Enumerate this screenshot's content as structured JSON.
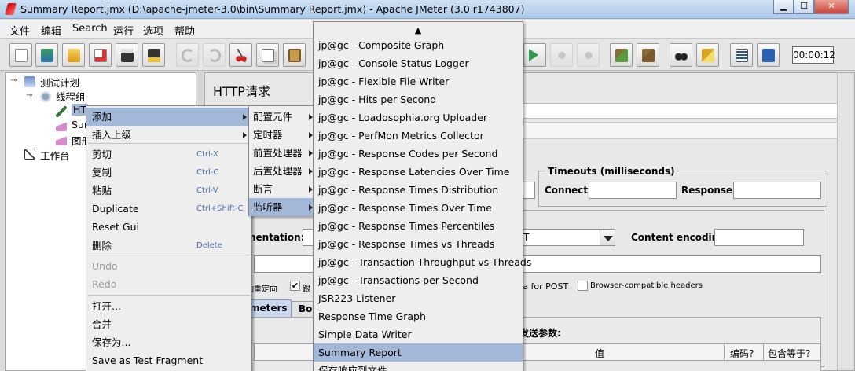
{
  "window": {
    "title": "Summary Report.jmx (D:\\apache-jmeter-3.0\\bin\\Summary Report.jmx) - Apache JMeter (3.0 r1743807)",
    "minimize": "▁",
    "maximize": "☐",
    "close": "✕"
  },
  "menubar": [
    "文件",
    "编辑",
    "Search",
    "运行",
    "选项",
    "帮助"
  ],
  "toolbar": {
    "timer": "00:00:12"
  },
  "tree": {
    "plan": "测试计划",
    "thread_group": "线程组",
    "http_partial": "HT",
    "summary_partial": "Sur",
    "graph_partial": "图册",
    "workbench": "工作台"
  },
  "panel": {
    "title": "HTTP请求",
    "timeouts_legend": "Timeouts (milliseconds)",
    "connect_label": "Connect:",
    "response_label": "Response:",
    "implementation_partial": "nentation:",
    "method_partial": "T",
    "content_encoding_label": "Content encoding:",
    "redirect_partial": "动重定向",
    "follow_partial": "跟",
    "multipart_partial": "ta for POST",
    "browser_headers": "Browser-compatible headers",
    "tab_params_partial": "meters",
    "tab_body_partial": "Bo",
    "send_params_partial": "发送参数:",
    "col_value": "值",
    "col_encode": "编码?",
    "col_include_equals": "包含等于?"
  },
  "context_menu": [
    {
      "label": "添加",
      "shortcut": "",
      "submenu": true,
      "selected": true,
      "disabled": false
    },
    {
      "label": "插入上级",
      "shortcut": "",
      "submenu": true,
      "selected": false,
      "disabled": false
    },
    {
      "label": "剪切",
      "shortcut": "Ctrl-X",
      "submenu": false,
      "selected": false,
      "disabled": false
    },
    {
      "label": "复制",
      "shortcut": "Ctrl-C",
      "submenu": false,
      "selected": false,
      "disabled": false
    },
    {
      "label": "粘贴",
      "shortcut": "Ctrl-V",
      "submenu": false,
      "selected": false,
      "disabled": false
    },
    {
      "label": "Duplicate",
      "shortcut": "Ctrl+Shift-C",
      "submenu": false,
      "selected": false,
      "disabled": false
    },
    {
      "label": "Reset Gui",
      "shortcut": "",
      "submenu": false,
      "selected": false,
      "disabled": false
    },
    {
      "label": "删除",
      "shortcut": "Delete",
      "submenu": false,
      "selected": false,
      "disabled": false
    },
    {
      "label": "Undo",
      "shortcut": "",
      "submenu": false,
      "selected": false,
      "disabled": true
    },
    {
      "label": "Redo",
      "shortcut": "",
      "submenu": false,
      "selected": false,
      "disabled": true
    },
    {
      "label": "打开...",
      "shortcut": "",
      "submenu": false,
      "selected": false,
      "disabled": false
    },
    {
      "label": "合并",
      "shortcut": "",
      "submenu": false,
      "selected": false,
      "disabled": false
    },
    {
      "label": "保存为...",
      "shortcut": "",
      "submenu": false,
      "selected": false,
      "disabled": false
    },
    {
      "label": "Save as Test Fragment",
      "shortcut": "",
      "submenu": false,
      "selected": false,
      "disabled": false
    }
  ],
  "add_submenu": [
    {
      "label": "配置元件",
      "selected": false
    },
    {
      "label": "定时器",
      "selected": false
    },
    {
      "label": "前置处理器",
      "selected": false
    },
    {
      "label": "后置处理器",
      "selected": false
    },
    {
      "label": "断言",
      "selected": false
    },
    {
      "label": "监听器",
      "selected": true
    }
  ],
  "listener_menu": {
    "scroll_up": "▲",
    "items": [
      {
        "label": "jp@gc - Composite Graph",
        "selected": false
      },
      {
        "label": "jp@gc - Console Status Logger",
        "selected": false
      },
      {
        "label": "jp@gc - Flexible File Writer",
        "selected": false
      },
      {
        "label": "jp@gc - Hits per Second",
        "selected": false
      },
      {
        "label": "jp@gc - Loadosophia.org Uploader",
        "selected": false
      },
      {
        "label": "jp@gc - PerfMon Metrics Collector",
        "selected": false
      },
      {
        "label": "jp@gc - Response Codes per Second",
        "selected": false
      },
      {
        "label": "jp@gc - Response Latencies Over Time",
        "selected": false
      },
      {
        "label": "jp@gc - Response Times Distribution",
        "selected": false
      },
      {
        "label": "jp@gc - Response Times Over Time",
        "selected": false
      },
      {
        "label": "jp@gc - Response Times Percentiles",
        "selected": false
      },
      {
        "label": "jp@gc - Response Times vs Threads",
        "selected": false
      },
      {
        "label": "jp@gc - Transaction Throughput vs Threads",
        "selected": false
      },
      {
        "label": "jp@gc - Transactions per Second",
        "selected": false
      },
      {
        "label": "JSR223 Listener",
        "selected": false
      },
      {
        "label": "Response Time Graph",
        "selected": false
      },
      {
        "label": "Simple Data Writer",
        "selected": false
      },
      {
        "label": "Summary Report",
        "selected": true
      },
      {
        "label": "保存响应到文件",
        "selected": false
      }
    ]
  },
  "colors": {
    "selection": "#a3b8d8",
    "menu_bg": "#eeeeee",
    "titlebar": "#aecbea"
  }
}
